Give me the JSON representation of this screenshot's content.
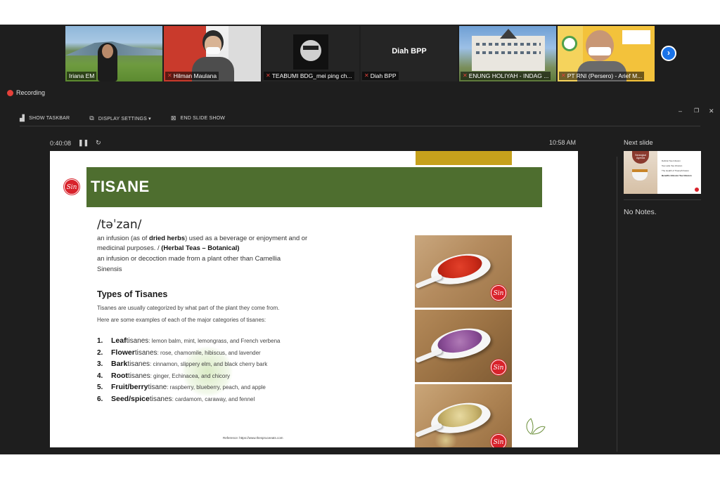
{
  "participants": [
    {
      "name": "Iriana EM",
      "muted": false,
      "active": true
    },
    {
      "name": "Hilman Maulana",
      "muted": true,
      "active": false
    },
    {
      "name": "TEABUMI BDG_mei ping ch...",
      "muted": true,
      "active": false
    },
    {
      "name": "Diah BPP",
      "muted": true,
      "active": false,
      "display_label": "Diah BPP"
    },
    {
      "name": "ENUNG HOLIYAH - INDAG ...",
      "muted": true,
      "active": false
    },
    {
      "name": "PT RNI (Persero) - Arief M...",
      "muted": true,
      "active": false
    }
  ],
  "recording_label": "Recording",
  "toolbar": {
    "show_taskbar": "SHOW TASKBAR",
    "display_settings": "DISPLAY SETTINGS ▾",
    "end_slide_show": "END SLIDE SHOW"
  },
  "timer": {
    "elapsed": "0:40:08",
    "clock": "10:58 AM"
  },
  "slide": {
    "title": "TISANE",
    "logo_text": "Sin",
    "phonetic": "/təˈzan/",
    "definition1": {
      "pre": "an infusion (as of ",
      "bold": "dried herbs",
      "post": ") used as a beverage or enjoyment and or"
    },
    "definition1b": {
      "pre": "medicinal purposes. / ",
      "bold": "(Herbal Teas – Botanical)"
    },
    "definition2": "an infusion or decoction made from a plant other than Camellia",
    "definition2b": "Sinensis",
    "types_heading": "Types of Tisanes",
    "intro1": "Tisanes are usually categorized by what part of the plant they come from.",
    "intro2": "Here are some examples of each of the major categories of tisanes:",
    "types": [
      {
        "num": "1.",
        "keyword": "Leaf",
        "word": " tisanes",
        "examples": ": lemon balm, mint, lemongrass, and French verbena"
      },
      {
        "num": "2.",
        "keyword": "Flower",
        "word": " tisanes",
        "examples": ": rose, chamomile, hibiscus, and lavender"
      },
      {
        "num": "3.",
        "keyword": "Bark",
        "word": " tisanes",
        "examples": ": cinnamon, slippery elm, and black cherry bark"
      },
      {
        "num": "4.",
        "keyword": "Root",
        "word": " tisanes",
        "examples": ": ginger, Echinacea, and chicory"
      },
      {
        "num": "5.",
        "keyword": "Fruit/berry",
        "word": " tisane",
        "examples": ": raspberry, blueberry, peach, and apple"
      },
      {
        "num": "6.",
        "keyword": "Seed/spice",
        "word": " tisanes",
        "examples": ": cardamom, caraway, and fennel"
      }
    ],
    "reference": "Reference: https://www.thespruceeats.com",
    "colors": {
      "title_band": "#4e6e2f",
      "gold_bar": "#c6a11c",
      "logo_red": "#d8222b"
    }
  },
  "right_panel": {
    "next_slide_label": "Next slide",
    "notes": "No Notes.",
    "thumb": {
      "badge": "Serangkai Agenda",
      "items": [
        "Definisi Tea Infusion",
        "Tea Latte Tea Infusion",
        "The Health of Tisane/Infusion",
        "Benefits Infusion Tea Infusion"
      ]
    }
  }
}
